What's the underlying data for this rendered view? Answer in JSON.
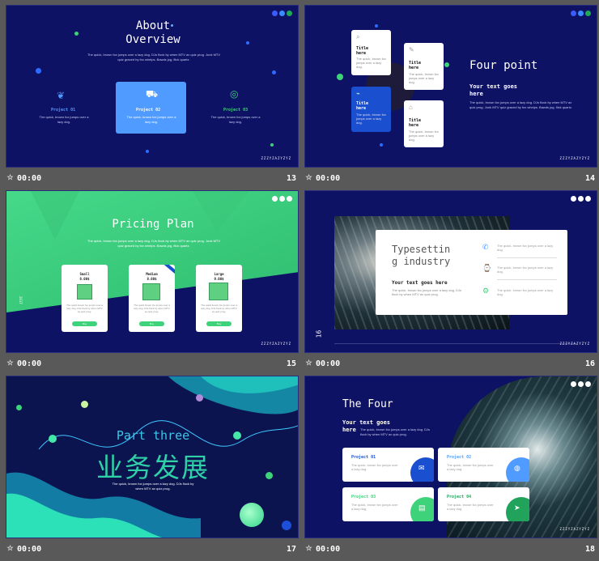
{
  "slides": [
    {
      "id": "s13",
      "number": "13",
      "time": "00:00",
      "title_line1": "About",
      "title_line2": "Overview",
      "body": "The quick, brown fox jumps over a lazy dog. DJs flock by when MTV ax quiz prog. Junk MTV quiz graced by fox whelps. Bawds jog, flick quartz.",
      "projects": [
        {
          "label": "Project 01",
          "text": "The quick, brown fox jumps over a lazy dog."
        },
        {
          "label": "Project 02",
          "text": "The quick, brown fox jumps over a lazy dog."
        },
        {
          "label": "Project 03",
          "text": "The quick, brown fox jumps over a lazy dog."
        }
      ],
      "logo": "ZZZYZAZYZYZ"
    },
    {
      "id": "s14",
      "number": "14",
      "time": "00:00",
      "title": "Four point",
      "subtitle_line1": "Your text goes",
      "subtitle_line2": "here",
      "body": "The quick, brown fox jumps over a lazy dog. DJs flock by when MTV ax quiz prog. Junk MTV quiz graced by fox whelps. Bawds jog, flick quartz.",
      "cards": [
        {
          "title_line1": "Title",
          "title_line2": "here",
          "text": "The quick, brown fox jumps over a lazy dog."
        },
        {
          "title_line1": "Title",
          "title_line2": "here",
          "text": "The quick, brown fox jumps over a lazy dog."
        },
        {
          "title_line1": "Title",
          "title_line2": "here",
          "text": "The quick, brown fox jumps over a lazy dog."
        },
        {
          "title_line1": "Title",
          "title_line2": "here",
          "text": "The quick, brown fox jumps over a lazy dog."
        }
      ],
      "logo": "ZZZYZAZYZYZ"
    },
    {
      "id": "s15",
      "number": "15",
      "time": "00:00",
      "title": "Pricing Plan",
      "body": "The quick, brown fox jumps over a lazy dog. DJs flock by when MTV ax quiz prog. Junk MTV quiz graced by fox whelps. Bawds jog, flick quartz.",
      "side_label": "2017",
      "plans": [
        {
          "name": "Small",
          "price": "6.00$",
          "text": "The quick brown fox jumps over a lazy dog. DJs flock by when MTV ax quiz prog.",
          "button": "Buy"
        },
        {
          "name": "Medium",
          "price": "8.00$",
          "text": "The quick brown fox jumps over a lazy dog. DJs flock by when MTV ax quiz prog.",
          "button": "Buy"
        },
        {
          "name": "Large",
          "price": "9.00$",
          "text": "The quick brown fox jumps over a lazy dog. DJs flock by when MTV ax quiz prog.",
          "button": "Buy"
        }
      ],
      "logo": "ZZZYZAZYZYZ"
    },
    {
      "id": "s16",
      "number": "16",
      "time": "00:00",
      "title_line1": "Typesettin",
      "title_line2": "g industry",
      "subtitle": "Your text goes here",
      "body": "The quick, brown fox jumps over a lazy dog. DJs flock by when MTV ax quiz prog.",
      "side_number": "16",
      "items": [
        {
          "text": "The quick, brown fox jumps over a lazy dog."
        },
        {
          "text": "The quick, brown fox jumps over a lazy dog."
        },
        {
          "text": "The quick, brown fox jumps over a lazy dog."
        }
      ],
      "logo": "ZZZYZAZYZYZ"
    },
    {
      "id": "s17",
      "number": "17",
      "time": "00:00",
      "title": "Part three",
      "chinese": "业务发展",
      "body_line1": "The quick, brown fox jumps over a lazy dog. DJs flock by",
      "body_line2": "when MTV ax quiz prog."
    },
    {
      "id": "s18",
      "number": "18",
      "time": "00:00",
      "title": "The Four",
      "subtitle_line1": "Your text goes",
      "subtitle_line2": "here",
      "body": "The quick, brown fox jumps over a lazy dog. DJs flock by when MTV ax quiz prog.",
      "projects": [
        {
          "label": "Project 01",
          "text": "The quick, brown fox jumps over a lazy dog."
        },
        {
          "label": "Project 02",
          "text": "The quick, brown fox jumps over a lazy dog."
        },
        {
          "label": "Project 03",
          "text": "The quick, brown fox jumps over a lazy dog."
        },
        {
          "label": "Project 04",
          "text": "The quick, brown fox jumps over a lazy dog."
        }
      ],
      "logo": "ZZZYZAZYZYZ"
    }
  ],
  "colors": {
    "navy": "#0e1265",
    "accent_blue": "#4f9bff",
    "green": "#3ed27a",
    "dark_green": "#21a35c",
    "royal_blue": "#1a4fd0"
  }
}
